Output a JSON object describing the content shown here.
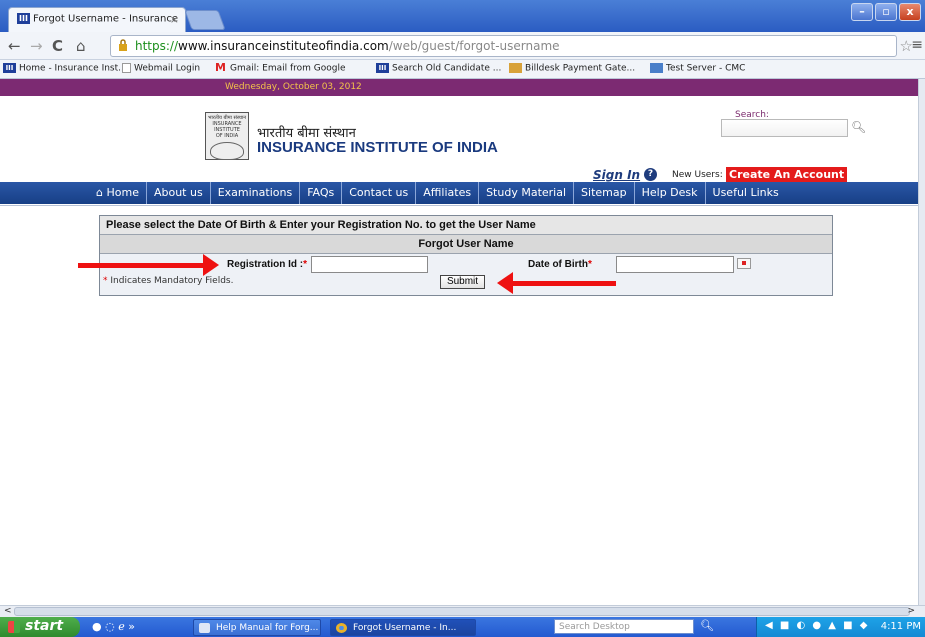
{
  "browser": {
    "tab_title": "Forgot Username - Insurance",
    "url_scheme": "https://",
    "url_domain": "www.insuranceinstituteofindia.com",
    "url_path": "/web/guest/forgot-username"
  },
  "bookmarks": [
    {
      "label": "Home - Insurance Inst...",
      "icon": "iii-icon"
    },
    {
      "label": "Webmail Login",
      "icon": "page-icon"
    },
    {
      "label": "Gmail: Email from Google",
      "icon": "gmail-icon"
    },
    {
      "label": "Search Old Candidate ...",
      "icon": "iii-icon"
    },
    {
      "label": "Billdesk Payment Gate...",
      "icon": "billdesk-icon"
    },
    {
      "label": "Test Server - CMC",
      "icon": "cmc-icon"
    }
  ],
  "page": {
    "date": "Wednesday, October 03, 2012",
    "org_hindi": "भारतीय बीमा संस्थान",
    "org_name": "INSURANCE INSTITUTE OF INDIA",
    "logo_text": "भारतीय बीमा संस्थान INSURANCE INSTITUTE OF INDIA",
    "search_label": "Search:",
    "sign_in": "Sign In",
    "new_users": "New Users:",
    "create_account": "Create An Account",
    "nav": [
      "Home",
      "About us",
      "Examinations",
      "FAQs",
      "Contact us",
      "Affiliates",
      "Study Material",
      "Sitemap",
      "Help Desk",
      "Useful Links"
    ]
  },
  "form": {
    "instruction": "Please select the Date Of Birth & Enter your Registration No. to get the User Name",
    "heading": "Forgot User Name",
    "reg_label": "Registration Id :",
    "reg_value": "",
    "dob_label": "Date of Birth",
    "dob_value": "",
    "required_mark": "*",
    "mandatory_note": "Indicates Mandatory Fields.",
    "submit": "Submit"
  },
  "taskbar": {
    "start": "start",
    "tasks": [
      "Help Manual for Forg...",
      "Forgot Username - In..."
    ],
    "search_placeholder": "Search Desktop",
    "clock": "4:11 PM"
  }
}
